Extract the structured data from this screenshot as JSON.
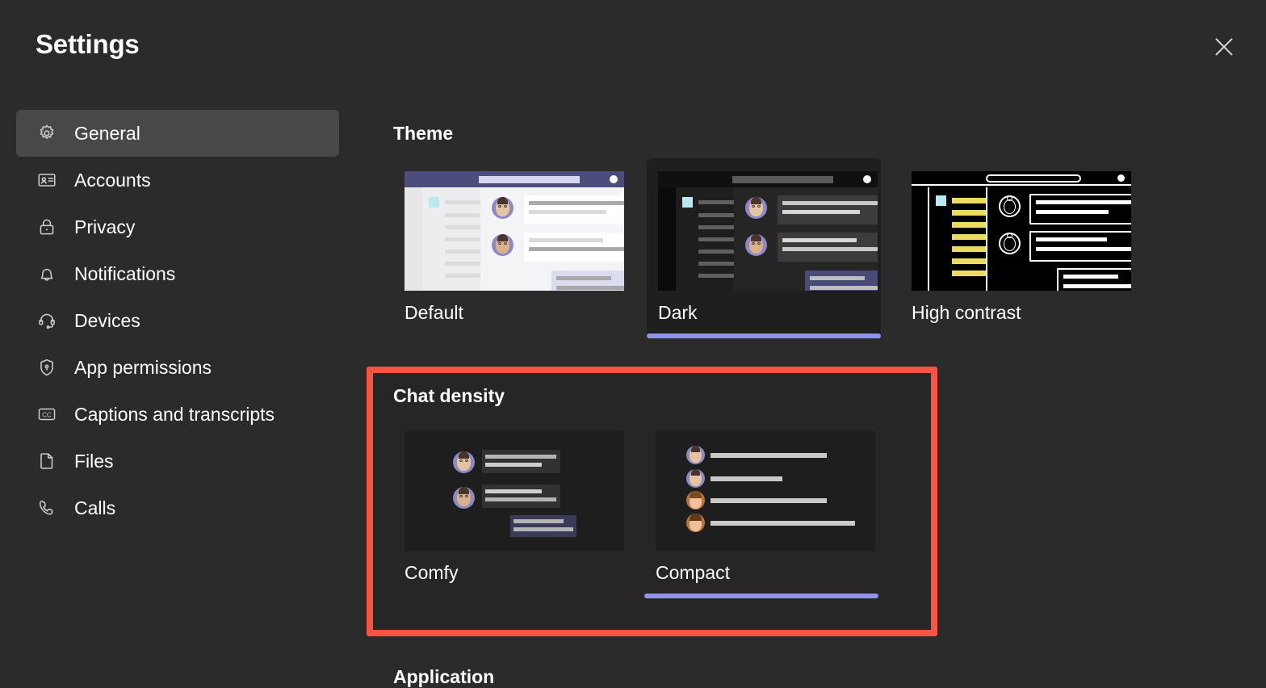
{
  "window": {
    "title": "Settings",
    "close_icon": "close-icon",
    "background_color": "#2b2b2b"
  },
  "sidebar": {
    "items": [
      {
        "label": "General",
        "icon": "gear-icon",
        "active": true
      },
      {
        "label": "Accounts",
        "icon": "id-card-icon",
        "active": false
      },
      {
        "label": "Privacy",
        "icon": "lock-icon",
        "active": false
      },
      {
        "label": "Notifications",
        "icon": "bell-icon",
        "active": false
      },
      {
        "label": "Devices",
        "icon": "headset-icon",
        "active": false
      },
      {
        "label": "App permissions",
        "icon": "shield-icon",
        "active": false
      },
      {
        "label": "Captions and transcripts",
        "icon": "cc-icon",
        "active": false
      },
      {
        "label": "Files",
        "icon": "file-icon",
        "active": false
      },
      {
        "label": "Calls",
        "icon": "phone-icon",
        "active": false
      }
    ],
    "active_background": "#484846"
  },
  "main": {
    "theme_section": {
      "heading": "Theme",
      "options": [
        {
          "label": "Default",
          "selected": false,
          "preview": "light-app-preview"
        },
        {
          "label": "Dark",
          "selected": true,
          "preview": "dark-app-preview"
        },
        {
          "label": "High contrast",
          "selected": false,
          "preview": "high-contrast-app-preview"
        }
      ]
    },
    "chat_density_section": {
      "heading": "Chat density",
      "highlighted": true,
      "highlight_color": "#fb5444",
      "options": [
        {
          "label": "Comfy",
          "selected": false,
          "preview": "comfy-chat-preview"
        },
        {
          "label": "Compact",
          "selected": true,
          "preview": "compact-chat-preview"
        }
      ]
    },
    "application_section": {
      "heading": "Application"
    },
    "selection_underline_color": "#9093ea"
  }
}
